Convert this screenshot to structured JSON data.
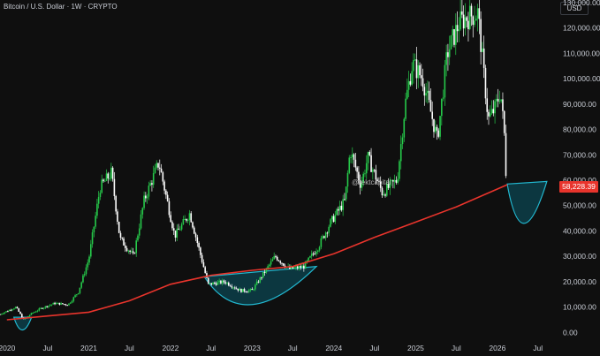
{
  "header": {
    "title": "Bitcoin / U.S. Dollar · 1W · CRYPTO",
    "currency_button": "USD"
  },
  "watermark": "@rektcapital",
  "colors": {
    "background": "#0f0f0f",
    "candle_up": "#26c94a",
    "candle_down": "#ffffff",
    "moving_average": "#e8342c",
    "projection_fill": "#0c3c46",
    "projection_stroke": "#22b8d0",
    "price_label_bg": "#e8342c"
  },
  "chart_data": {
    "type": "candlestick",
    "title": "Bitcoin / U.S. Dollar · 1W · CRYPTO",
    "ylim": [
      -3000,
      131000
    ],
    "xlim": [
      "2019-12-01",
      "2026-10-01"
    ],
    "y_ticks": [
      "130,000.00",
      "120,000.00",
      "110,000.00",
      "100,000.00",
      "90,000.00",
      "80,000.00",
      "70,000.00",
      "60,000.00",
      "50,000.00",
      "40,000.00",
      "30,000.00",
      "20,000.00",
      "10,000.00",
      "0.00"
    ],
    "x_ticks": [
      {
        "label": "2020",
        "date": "2020-01-01"
      },
      {
        "label": "Jul",
        "date": "2020-07-01"
      },
      {
        "label": "2021",
        "date": "2021-01-01"
      },
      {
        "label": "Jul",
        "date": "2021-07-01"
      },
      {
        "label": "2022",
        "date": "2022-01-01"
      },
      {
        "label": "Jul",
        "date": "2022-07-01"
      },
      {
        "label": "2023",
        "date": "2023-01-01"
      },
      {
        "label": "Jul",
        "date": "2023-07-01"
      },
      {
        "label": "2024",
        "date": "2024-01-01"
      },
      {
        "label": "Jul",
        "date": "2024-07-01"
      },
      {
        "label": "2025",
        "date": "2025-01-01"
      },
      {
        "label": "Jul",
        "date": "2025-07-01"
      },
      {
        "label": "2026",
        "date": "2026-01-01"
      },
      {
        "label": "Jul",
        "date": "2026-07-01"
      }
    ],
    "last_price_label": "58,228.39",
    "price_path": [
      [
        "2019-12-01",
        7200
      ],
      [
        "2020-02-10",
        10000
      ],
      [
        "2020-03-16",
        5000
      ],
      [
        "2020-04-20",
        7500
      ],
      [
        "2020-06-01",
        9500
      ],
      [
        "2020-08-01",
        11500
      ],
      [
        "2020-10-01",
        11000
      ],
      [
        "2020-11-15",
        16000
      ],
      [
        "2021-01-01",
        29000
      ],
      [
        "2021-02-20",
        57000
      ],
      [
        "2021-04-12",
        63000
      ],
      [
        "2021-05-20",
        37000
      ],
      [
        "2021-07-20",
        30000
      ],
      [
        "2021-09-05",
        52000
      ],
      [
        "2021-11-10",
        67000
      ],
      [
        "2022-01-20",
        38000
      ],
      [
        "2022-03-28",
        47000
      ],
      [
        "2022-06-18",
        19000
      ],
      [
        "2022-09-01",
        20000
      ],
      [
        "2022-11-10",
        16500
      ],
      [
        "2023-01-01",
        16600
      ],
      [
        "2023-04-14",
        30000
      ],
      [
        "2023-06-15",
        25000
      ],
      [
        "2023-08-20",
        26000
      ],
      [
        "2023-10-25",
        34000
      ],
      [
        "2023-12-15",
        43000
      ],
      [
        "2024-02-20",
        52000
      ],
      [
        "2024-03-14",
        72000
      ],
      [
        "2024-05-01",
        58000
      ],
      [
        "2024-06-01",
        69000
      ],
      [
        "2024-08-05",
        55000
      ],
      [
        "2024-10-10",
        60000
      ],
      [
        "2024-11-15",
        90000
      ],
      [
        "2024-12-17",
        106000
      ],
      [
        "2025-02-01",
        100000
      ],
      [
        "2025-04-08",
        76000
      ],
      [
        "2025-05-22",
        110000
      ],
      [
        "2025-07-14",
        122000
      ],
      [
        "2025-08-14",
        124000
      ],
      [
        "2025-10-06",
        126000
      ],
      [
        "2025-11-21",
        84000
      ],
      [
        "2025-12-20",
        88000
      ],
      [
        "2026-01-15",
        95000
      ],
      [
        "2026-02-01",
        78000
      ],
      [
        "2026-02-06",
        65000
      ],
      [
        "2026-02-14",
        58228
      ]
    ],
    "moving_average": [
      [
        "2020-01-01",
        5000
      ],
      [
        "2020-07-01",
        6500
      ],
      [
        "2021-01-01",
        8000
      ],
      [
        "2021-07-01",
        12500
      ],
      [
        "2022-01-01",
        19000
      ],
      [
        "2022-07-01",
        22500
      ],
      [
        "2023-01-01",
        24500
      ],
      [
        "2023-07-01",
        26000
      ],
      [
        "2024-01-01",
        31000
      ],
      [
        "2024-07-01",
        37500
      ],
      [
        "2025-01-01",
        43500
      ],
      [
        "2025-07-01",
        49500
      ],
      [
        "2026-02-14",
        58228
      ]
    ],
    "projection_arcs": [
      {
        "start": [
          "2020-02-01",
          6000
        ],
        "end": [
          "2020-04-20",
          6000
        ],
        "bottom": [
          "2020-03-10",
          1000
        ]
      },
      {
        "start": [
          "2022-06-01",
          22000
        ],
        "end": [
          "2023-10-15",
          26000
        ],
        "bottom": [
          "2023-01-01",
          11000
        ]
      },
      {
        "start": [
          "2026-02-14",
          58500
        ],
        "end": [
          "2026-08-10",
          59500
        ],
        "bottom": [
          "2026-05-01",
          43000
        ]
      }
    ]
  }
}
